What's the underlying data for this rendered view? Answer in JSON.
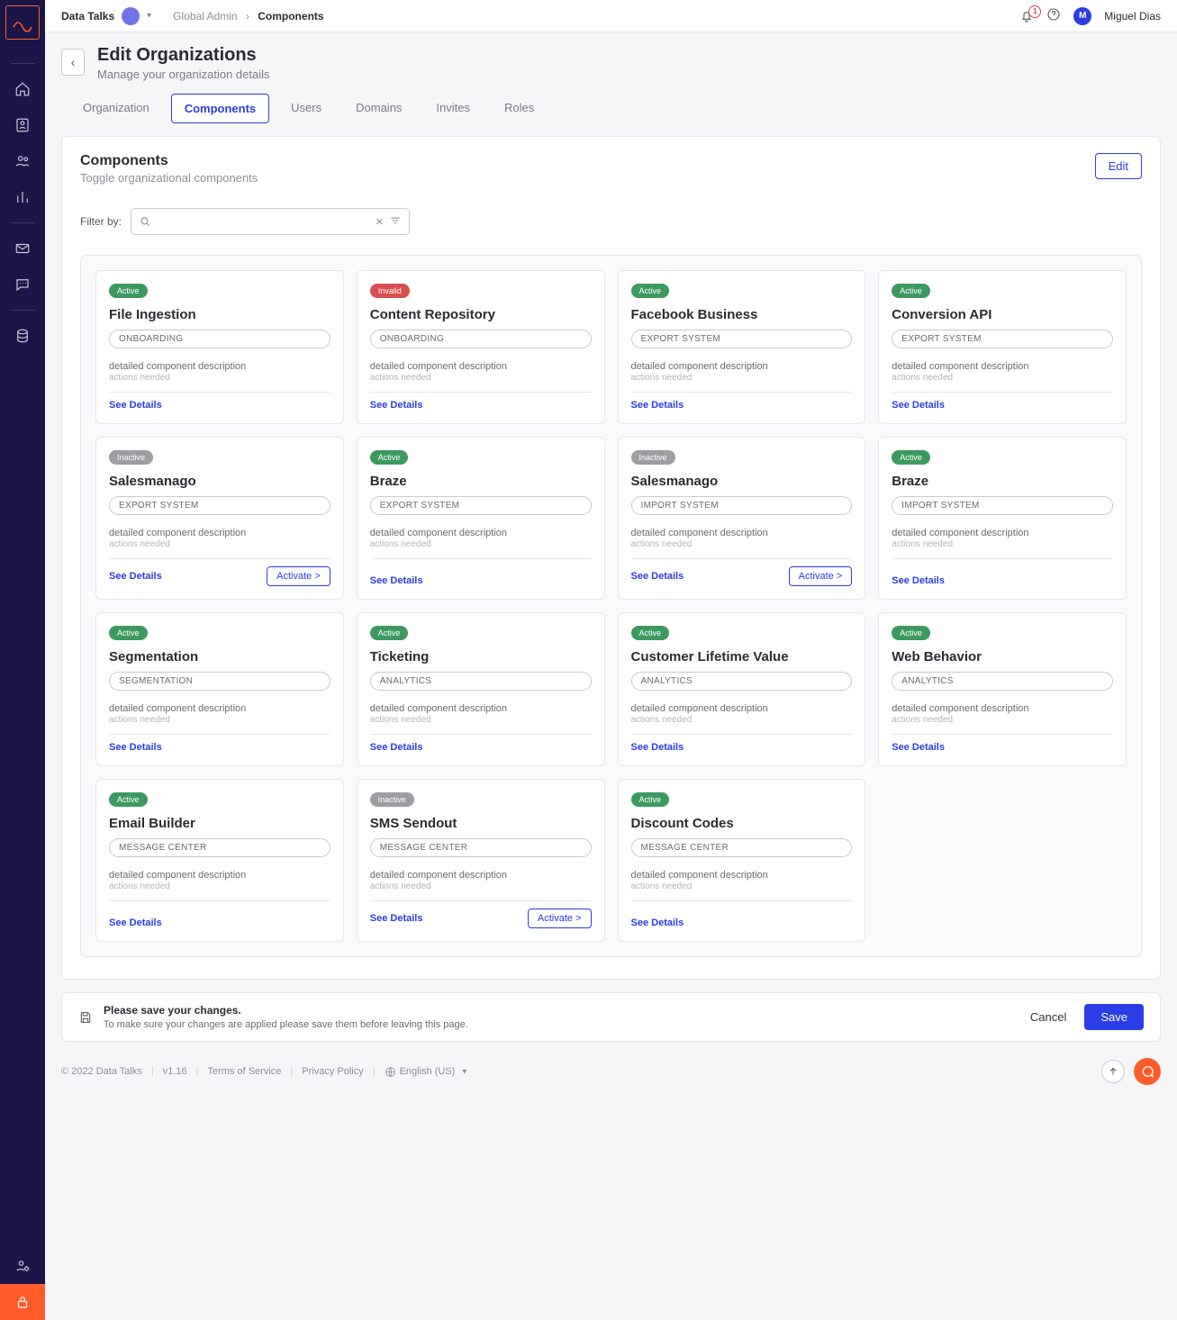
{
  "header": {
    "org": "Data Talks",
    "breadcrumb1": "Global Admin",
    "breadcrumb2": "Components",
    "notif_count": "1",
    "user_initial": "M",
    "user_name": "Miguel Dias"
  },
  "page": {
    "title": "Edit Organizations",
    "subtitle": "Manage your organization details"
  },
  "tabs": [
    "Organization",
    "Components",
    "Users",
    "Domains",
    "Invites",
    "Roles"
  ],
  "active_tab": "Components",
  "panel": {
    "title": "Components",
    "subtitle": "Toggle organizational components",
    "edit": "Edit",
    "filter_label": "Filter by:",
    "see_details": "See Details",
    "activate": "Activate >",
    "desc": "detailed component description",
    "actions": "actions needed"
  },
  "cards": [
    {
      "status": "Active",
      "title": "File Ingestion",
      "cat": "ONBOARDING",
      "cta": "toggle"
    },
    {
      "status": "Invalid",
      "title": "Content Repository",
      "cat": "ONBOARDING",
      "cta": "none"
    },
    {
      "status": "Active",
      "title": "Facebook Business",
      "cat": "EXPORT SYSTEM",
      "cta": "toggle"
    },
    {
      "status": "Active",
      "title": "Conversion API",
      "cat": "EXPORT SYSTEM",
      "cta": "toggle"
    },
    {
      "status": "Inactive",
      "title": "Salesmanago",
      "cat": "EXPORT SYSTEM",
      "cta": "activate"
    },
    {
      "status": "Active",
      "title": "Braze",
      "cat": "EXPORT SYSTEM",
      "cta": "toggle"
    },
    {
      "status": "Inactive",
      "title": "Salesmanago",
      "cat": "IMPORT SYSTEM",
      "cta": "activate"
    },
    {
      "status": "Active",
      "title": "Braze",
      "cat": "IMPORT SYSTEM",
      "cta": "toggle"
    },
    {
      "status": "Active",
      "title": "Segmentation",
      "cat": "SEGMENTATION",
      "cta": "toggle"
    },
    {
      "status": "Active",
      "title": "Ticketing",
      "cat": "ANALYTICS",
      "cta": "toggle"
    },
    {
      "status": "Active",
      "title": "Customer Lifetime Value",
      "cat": "ANALYTICS",
      "cta": "toggle"
    },
    {
      "status": "Active",
      "title": "Web Behavior",
      "cat": "ANALYTICS",
      "cta": "toggle"
    },
    {
      "status": "Active",
      "title": "Email Builder",
      "cat": "MESSAGE CENTER",
      "cta": "toggle"
    },
    {
      "status": "Inactive",
      "title": "SMS Sendout",
      "cat": "MESSAGE CENTER",
      "cta": "activate"
    },
    {
      "status": "Active",
      "title": "Discount Codes",
      "cat": "MESSAGE CENTER",
      "cta": "toggle"
    }
  ],
  "savebar": {
    "title": "Please save your changes.",
    "msg": "To make sure your changes are applied please save them before leaving this page.",
    "cancel": "Cancel",
    "save": "Save"
  },
  "footer": {
    "copyright": "© 2022 Data Talks",
    "version": "v1.16",
    "tos": "Terms of Service",
    "privacy": "Privacy Policy",
    "lang": "English (US)"
  }
}
